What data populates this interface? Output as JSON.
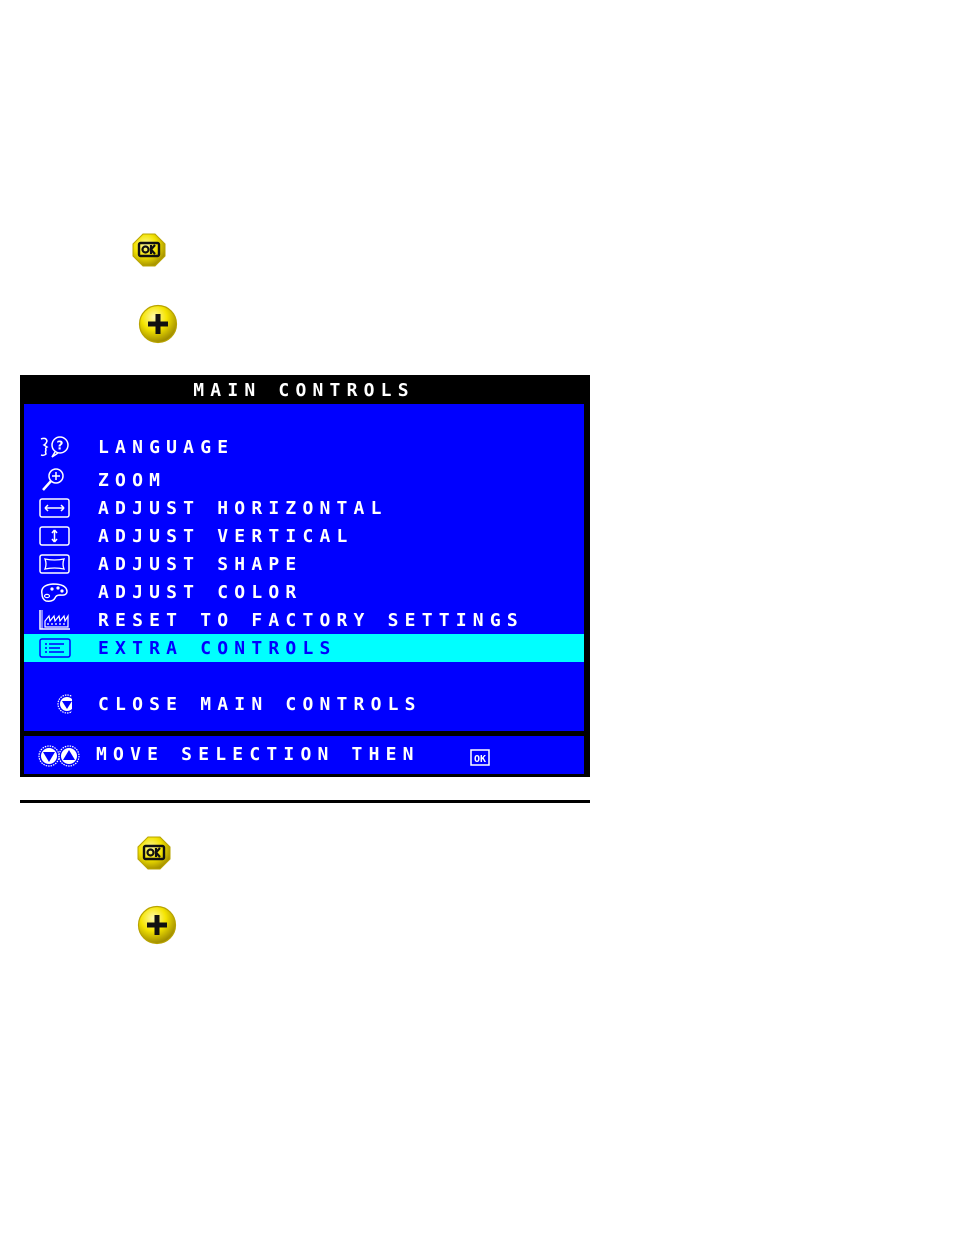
{
  "steps_top": [
    {
      "icon": "ok-button-icon",
      "label": "OK"
    },
    {
      "icon": "plus-button-icon",
      "label": "+"
    }
  ],
  "osd": {
    "title": "MAIN CONTROLS",
    "items": [
      {
        "icon": "language-icon",
        "label": "LANGUAGE",
        "selected": false
      },
      {
        "icon": "zoom-icon",
        "label": "ZOOM",
        "selected": false
      },
      {
        "icon": "adjust-horizontal-icon",
        "label": "ADJUST HORIZONTAL",
        "selected": false
      },
      {
        "icon": "adjust-vertical-icon",
        "label": "ADJUST VERTICAL",
        "selected": false
      },
      {
        "icon": "adjust-shape-icon",
        "label": "ADJUST SHAPE",
        "selected": false
      },
      {
        "icon": "adjust-color-icon",
        "label": "ADJUST COLOR",
        "selected": false
      },
      {
        "icon": "factory-icon",
        "label": "RESET TO FACTORY SETTINGS",
        "selected": false
      },
      {
        "icon": "extra-controls-icon",
        "label": "EXTRA CONTROLS",
        "selected": true
      }
    ],
    "close": {
      "icon": "down-arrow-circle-icon",
      "label": "CLOSE MAIN CONTROLS"
    },
    "footer": {
      "label": "MOVE SELECTION THEN",
      "end_icon": "ok-key-icon"
    },
    "colors": {
      "background": "#0000ff",
      "title_bar": "#000000",
      "highlight": "#00ffff",
      "text": "#ffffff",
      "highlight_text": "#0000ff"
    }
  },
  "steps_bottom": [
    {
      "icon": "ok-button-icon",
      "label": "OK"
    },
    {
      "icon": "plus-button-icon",
      "label": "+"
    }
  ]
}
